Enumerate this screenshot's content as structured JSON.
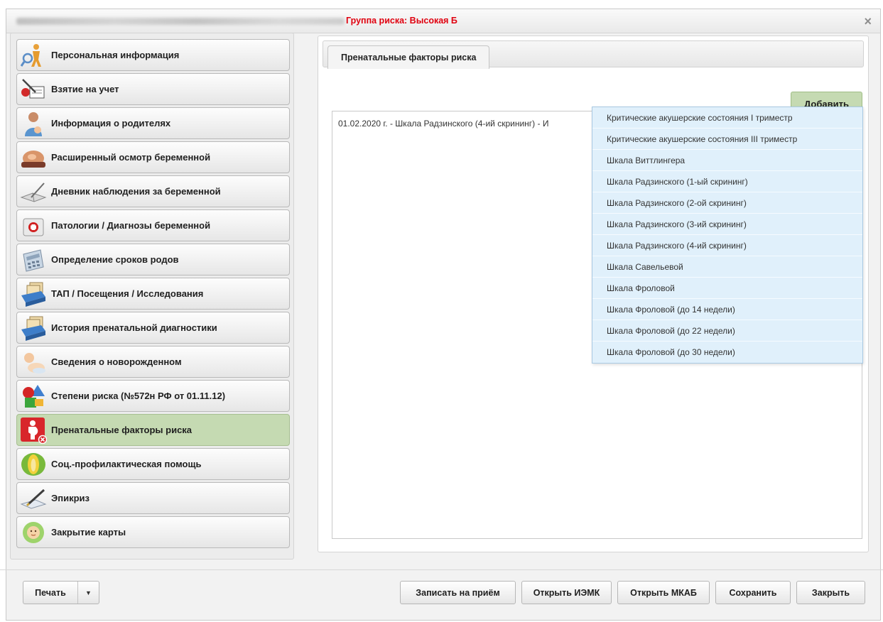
{
  "window": {
    "risk_title": "Группа риска: Высокая Б",
    "close_icon": "×"
  },
  "sidebar": {
    "items": [
      {
        "label": "Персональная информация",
        "icon": "person-search-icon"
      },
      {
        "label": "Взятие на учет",
        "icon": "register-form-icon"
      },
      {
        "label": "Информация о родителях",
        "icon": "parent-icon"
      },
      {
        "label": "Расширенный осмотр беременной",
        "icon": "pregnant-exam-icon"
      },
      {
        "label": "Дневник наблюдения за беременной",
        "icon": "diary-book-icon"
      },
      {
        "label": "Патологии / Диагнозы беременной",
        "icon": "medical-case-icon"
      },
      {
        "label": "Определение сроков родов",
        "icon": "calculator-icon"
      },
      {
        "label": "ТАП / Посещения / Исследования",
        "icon": "card-file-icon"
      },
      {
        "label": "История пренатальной диагностики",
        "icon": "card-file-icon"
      },
      {
        "label": "Сведения о новорожденном",
        "icon": "newborn-icon"
      },
      {
        "label": "Степени риска (№572н РФ от 01.11.12)",
        "icon": "risk-shapes-icon"
      },
      {
        "label": "Пренатальные факторы риска",
        "icon": "prenatal-risk-icon",
        "active": true
      },
      {
        "label": "Соц.-профилактическая помощь",
        "icon": "social-help-icon"
      },
      {
        "label": "Эпикриз",
        "icon": "pen-icon"
      },
      {
        "label": "Закрытие карты",
        "icon": "baby-close-icon"
      }
    ]
  },
  "main": {
    "tab_label": "Пренатальные факторы риска",
    "add_label": "Добавить",
    "list_row": "01.02.2020 г. - Шкала Радзинского (4-ий скрининг) - И"
  },
  "dropdown": {
    "items": [
      "Критические акушерские состояния I триместр",
      "Критические акушерские состояния III триместр",
      "Шкала Виттлингера",
      "Шкала Радзинского (1-ый скрининг)",
      "Шкала Радзинского (2-ой скрининг)",
      "Шкала Радзинского (3-ий скрининг)",
      "Шкала Радзинского (4-ий скрининг)",
      "Шкала Савельевой",
      "Шкала Фроловой",
      "Шкала Фроловой (до 14 недели)",
      "Шкала Фроловой (до 22 недели)",
      "Шкала Фроловой (до 30 недели)"
    ]
  },
  "footer": {
    "print": "Печать",
    "appointment": "Записать на приём",
    "open_iemk": "Открыть ИЭМК",
    "open_mkab": "Открыть МКАБ",
    "save": "Сохранить",
    "close": "Закрыть"
  },
  "colors": {
    "risk_title": "#e0000f",
    "active_item": "#c5dab2",
    "dropdown_bg": "#e0f0fb"
  }
}
